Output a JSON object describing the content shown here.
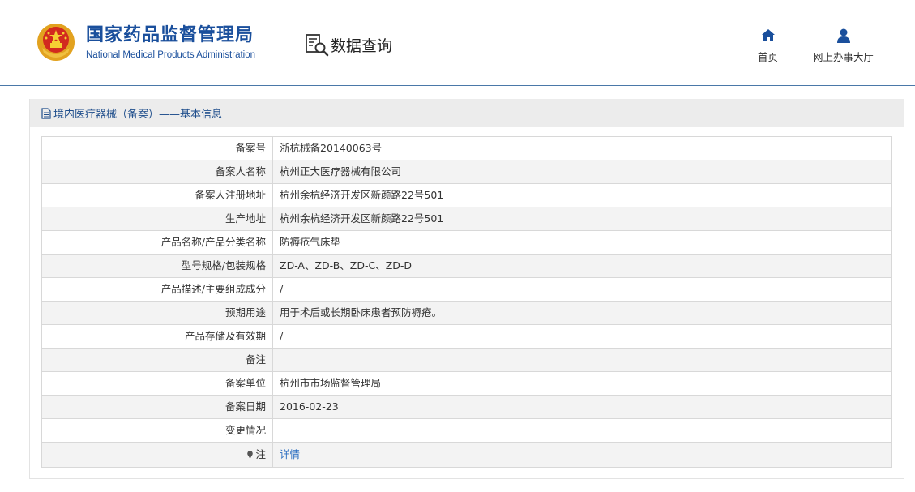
{
  "header": {
    "org_name_cn": "国家药品监督管理局",
    "org_name_en": "National Medical Products Administration",
    "section_title": "数据查询",
    "nav": [
      {
        "label": "首页",
        "icon": "home-icon"
      },
      {
        "label": "网上办事大厅",
        "icon": "user-icon"
      }
    ]
  },
  "panel": {
    "title": "境内医疗器械（备案）——基本信息",
    "rows": [
      {
        "label": "备案号",
        "value": "浙杭械备20140063号"
      },
      {
        "label": "备案人名称",
        "value": "杭州正大医疗器械有限公司"
      },
      {
        "label": "备案人注册地址",
        "value": "杭州余杭经济开发区新颜路22号501"
      },
      {
        "label": "生产地址",
        "value": "杭州余杭经济开发区新颜路22号501"
      },
      {
        "label": "产品名称/产品分类名称",
        "value": "防褥疮气床垫"
      },
      {
        "label": "型号规格/包装规格",
        "value": "ZD-A、ZD-B、ZD-C、ZD-D"
      },
      {
        "label": "产品描述/主要组成成分",
        "value": "/"
      },
      {
        "label": "预期用途",
        "value": "用于术后或长期卧床患者预防褥疮。"
      },
      {
        "label": "产品存储及有效期",
        "value": "/"
      },
      {
        "label": "备注",
        "value": ""
      },
      {
        "label": "备案单位",
        "value": "杭州市市场监督管理局"
      },
      {
        "label": "备案日期",
        "value": "2016-02-23"
      },
      {
        "label": "变更情况",
        "value": ""
      },
      {
        "label": "注",
        "value": "详情"
      }
    ]
  },
  "colors": {
    "brand_blue": "#1a4f9c",
    "link_blue": "#2a6dc0",
    "header_rule": "#4a78a8"
  }
}
